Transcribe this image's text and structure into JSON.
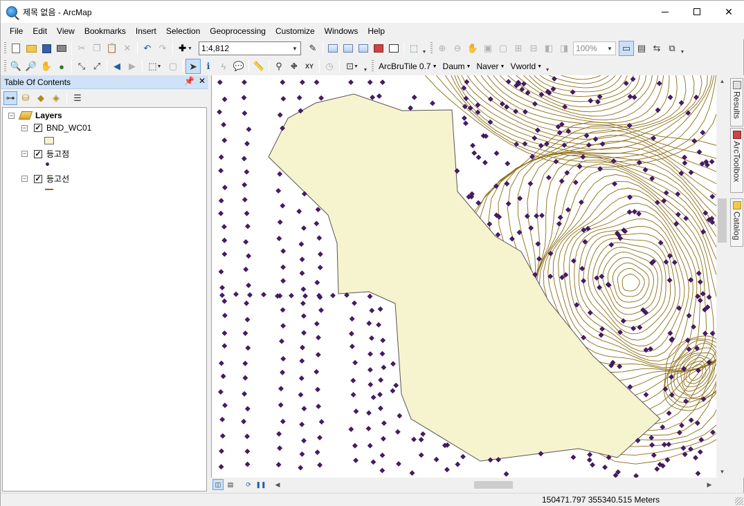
{
  "window": {
    "title": "제목 없음 - ArcMap"
  },
  "menu": [
    "File",
    "Edit",
    "View",
    "Bookmarks",
    "Insert",
    "Selection",
    "Geoprocessing",
    "Customize",
    "Windows",
    "Help"
  ],
  "toolbar": {
    "scale": "1:4,812",
    "zoom_percent": "100%",
    "plugin_menus": [
      "ArcBruTile 0.7",
      "Daum",
      "Naver",
      "Vworld"
    ]
  },
  "toc": {
    "title": "Table Of Contents",
    "root": "Layers",
    "layers": [
      {
        "name": "BND_WC01",
        "checked": true,
        "symbol": "polygon"
      },
      {
        "name": "등고점",
        "checked": true,
        "symbol": "point"
      },
      {
        "name": "등고선",
        "checked": true,
        "symbol": "line"
      }
    ]
  },
  "dock_tabs": [
    "Results",
    "ArcToolbox",
    "Catalog"
  ],
  "map": {
    "polygon_fill": "#f6f3cf",
    "point_color": "#4a1a6a",
    "contour_color": "#8b6b13"
  },
  "status": {
    "coordinates": "150471.797  355340.515 Meters"
  }
}
